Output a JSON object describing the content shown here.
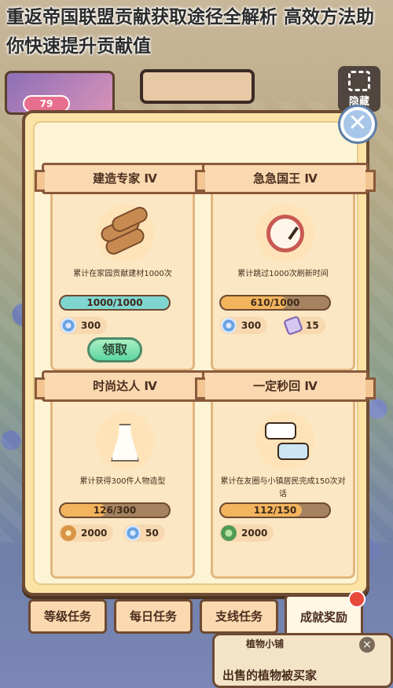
{
  "headline": "重返帝国联盟贡献获取途径全解析 高效方法助你快速提升贡献值",
  "top_left_badge": "79",
  "hide_button": {
    "label": "隐藏",
    "icon": "frame-icon"
  },
  "close_icon": "close-icon",
  "cards": [
    {
      "title": "建造专家 Ⅳ",
      "art_icon": "logs-icon",
      "description": "累计在家园贡献建材1000次",
      "progress_text": "1000/1000",
      "progress_fraction": 1.0,
      "progress_color": "#7fd6d0",
      "rewards": [
        {
          "icon": "swirl-icon",
          "amount": "300"
        }
      ],
      "claim_label": "领取"
    },
    {
      "title": "急急国王 Ⅳ",
      "art_icon": "clock-icon",
      "description": "累计跳过1000次刷新时间",
      "progress_text": "610/1000",
      "progress_fraction": 0.61,
      "progress_color": "#f3b45e",
      "rewards": [
        {
          "icon": "swirl-icon",
          "amount": "300"
        },
        {
          "icon": "ticket-icon",
          "amount": "15"
        }
      ]
    },
    {
      "title": "时尚达人 Ⅳ",
      "art_icon": "dress-icon",
      "description": "累计获得300件人物造型",
      "progress_text": "126/300",
      "progress_fraction": 0.42,
      "progress_color": "#f3b45e",
      "rewards": [
        {
          "icon": "coin-icon",
          "amount": "2000"
        },
        {
          "icon": "swirl-icon",
          "amount": "50"
        }
      ]
    },
    {
      "title": "一定秒回 Ⅳ",
      "art_icon": "chat-bubbles-icon",
      "description": "累计在友圈与小镇居民完成150次对话",
      "progress_text": "112/150",
      "progress_fraction": 0.747,
      "progress_color": "#f3b45e",
      "rewards": [
        {
          "icon": "clover-icon",
          "amount": "2000"
        }
      ]
    }
  ],
  "tabs": [
    {
      "label": "等级任务",
      "active": false
    },
    {
      "label": "每日任务",
      "active": false
    },
    {
      "label": "支线任务",
      "active": false
    },
    {
      "label": "成就奖励",
      "active": true
    }
  ],
  "shop_card": {
    "sub_label": "植物小铺",
    "message": "出售的植物被买家"
  }
}
